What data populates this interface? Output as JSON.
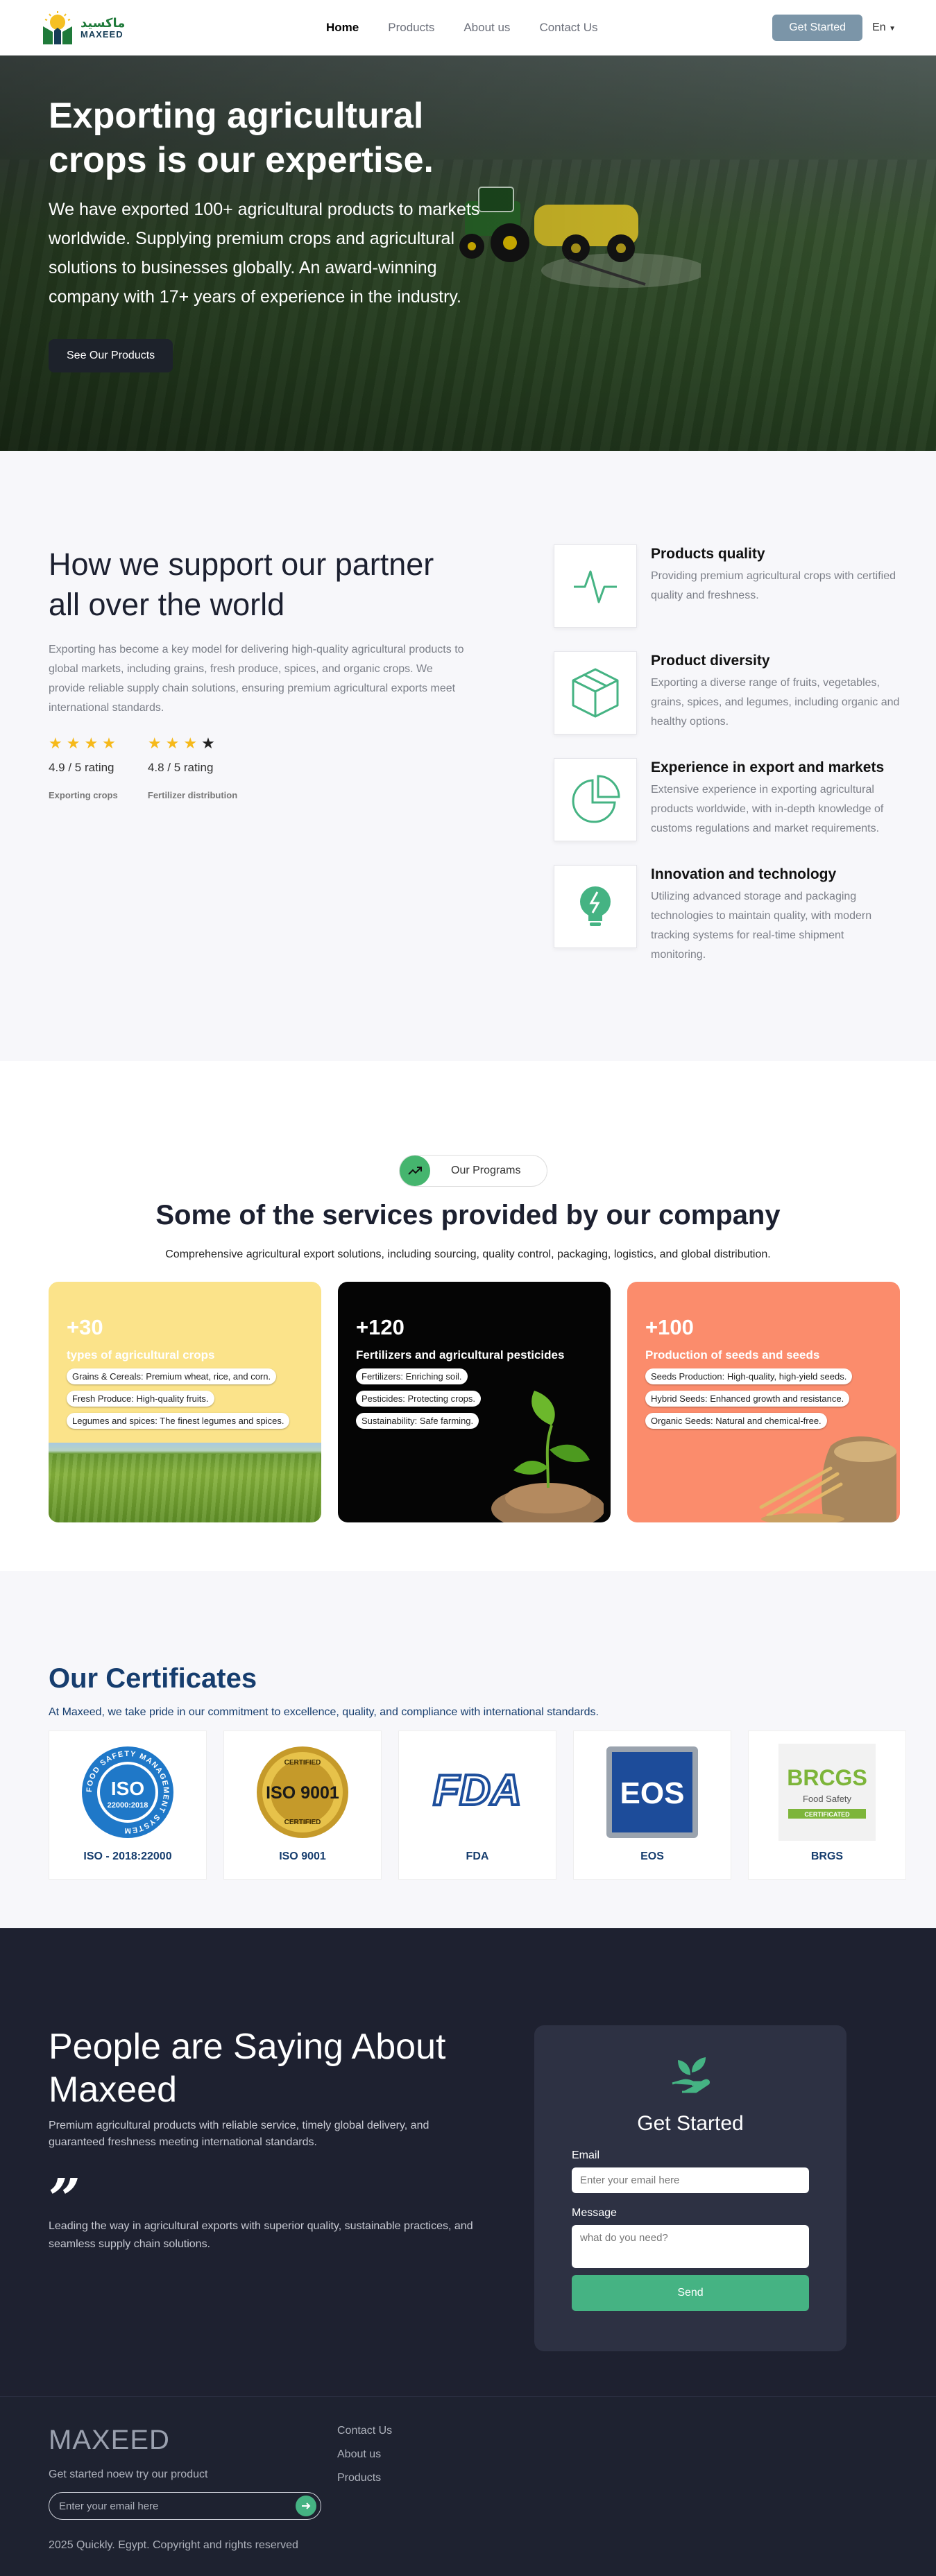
{
  "nav": {
    "logo_ar": "ماكسيد",
    "logo_en": "MAXEED",
    "links": [
      "Home",
      "Products",
      "About us",
      "Contact Us"
    ],
    "cta": "Get Started",
    "lang": "En"
  },
  "hero": {
    "title": "Exporting agricultural crops is our expertise.",
    "text": "We have exported 100+ agricultural products to markets worldwide. Supplying premium crops and agricultural solutions to businesses globally. An award-winning company with 17+ years of experience in the industry.",
    "button": "See Our Products"
  },
  "support": {
    "title": "How we support our partner all over the world",
    "text": "Exporting has become a key model for delivering high-quality agricultural products to global markets, including grains, fresh produce, spices, and organic crops. We provide reliable supply chain solutions, ensuring premium agricultural exports meet international standards.",
    "ratings": [
      {
        "value": "4.9 / 5 rating",
        "label": "Exporting crops",
        "stars": 4
      },
      {
        "value": "4.8 / 5 rating",
        "label": "Fertilizer distribution",
        "stars": 3
      }
    ],
    "features": [
      {
        "title": "Products quality",
        "text": "Providing premium agricultural crops with certified quality and freshness.",
        "icon": "pulse-icon"
      },
      {
        "title": "Product diversity",
        "text": "Exporting a diverse range of fruits, vegetables, grains, spices, and legumes, including organic and healthy options.",
        "icon": "box-icon"
      },
      {
        "title": "Experience in export and markets",
        "text": "Extensive experience in exporting agricultural products worldwide, with in-depth knowledge of customs regulations and market requirements.",
        "icon": "pie-chart-icon"
      },
      {
        "title": "Innovation and technology",
        "text": "Utilizing advanced storage and packaging technologies to maintain quality, with modern tracking systems for real-time shipment monitoring.",
        "icon": "lightbulb-icon"
      }
    ]
  },
  "services": {
    "pill": "Our Programs",
    "title": "Some of the services provided by our company",
    "subtitle": "Comprehensive agricultural export solutions, including sourcing, quality control, packaging, logistics, and global distribution.",
    "cards": [
      {
        "num": "+30",
        "title": "types of agricultural crops",
        "items": [
          "Grains & Cereals: Premium wheat, rice, and corn.",
          "Fresh Produce: High-quality fruits.",
          "Legumes and spices: The finest legumes and spices."
        ],
        "bg": "#fbe38a"
      },
      {
        "num": "+120",
        "title": "Fertilizers and agricultural pesticides",
        "items": [
          "Fertilizers: Enriching soil.",
          "Pesticides: Protecting crops.",
          "Sustainability: Safe farming."
        ],
        "bg": "#050505"
      },
      {
        "num": "+100",
        "title": "Production of seeds and seeds",
        "items": [
          "Seeds Production: High-quality, high-yield seeds.",
          "Hybrid Seeds: Enhanced growth and resistance.",
          "Organic Seeds: Natural and chemical-free."
        ],
        "bg": "#fb8c6c"
      }
    ]
  },
  "certs": {
    "title": "Our Certificates",
    "subtitle": "At Maxeed, we take pride in our commitment to excellence, quality, and compliance with international standards.",
    "items": [
      {
        "label": "ISO - 2018:22000",
        "badge_main": "ISO",
        "badge_sub": "22000:2018",
        "badge_ring": "FOOD SAFETY MANAGEMENT SYSTEM"
      },
      {
        "label": "ISO 9001",
        "badge_main": "ISO 9001",
        "badge_top": "CERTIFIED",
        "badge_bottom": "CERTIFIED"
      },
      {
        "label": "FDA",
        "badge_main": "FDA"
      },
      {
        "label": "EOS",
        "badge_main": "EOS"
      },
      {
        "label": "BRGS",
        "badge_main": "BRCGS",
        "badge_sub": "Food Safety",
        "badge_ribbon": "CERTIFICATED"
      }
    ]
  },
  "testimonials": {
    "title": "People are Saying About Maxeed",
    "text": "Premium agricultural products with reliable service, timely global delivery, and guaranteed freshness meeting international standards.",
    "quote_mark": "”",
    "quote": "Leading the way in agricultural exports with superior quality, sustainable practices, and seamless supply chain solutions."
  },
  "form": {
    "title": "Get Started",
    "email_label": "Email",
    "email_placeholder": "Enter your email here",
    "message_label": "Message",
    "message_placeholder": "what do you need?",
    "send": "Send"
  },
  "footer": {
    "brand": "MAXEED",
    "tagline": "Get started noew try our product",
    "email_placeholder": "Enter your email here",
    "links": [
      "Contact Us",
      "About us",
      "Products"
    ],
    "copyright": "2025 Quickly. Egypt. Copyright and rights reserved"
  },
  "colors": {
    "accent": "#45b383",
    "navy": "#163d6e",
    "dark": "#1e2130",
    "star": "#f6b91a"
  }
}
